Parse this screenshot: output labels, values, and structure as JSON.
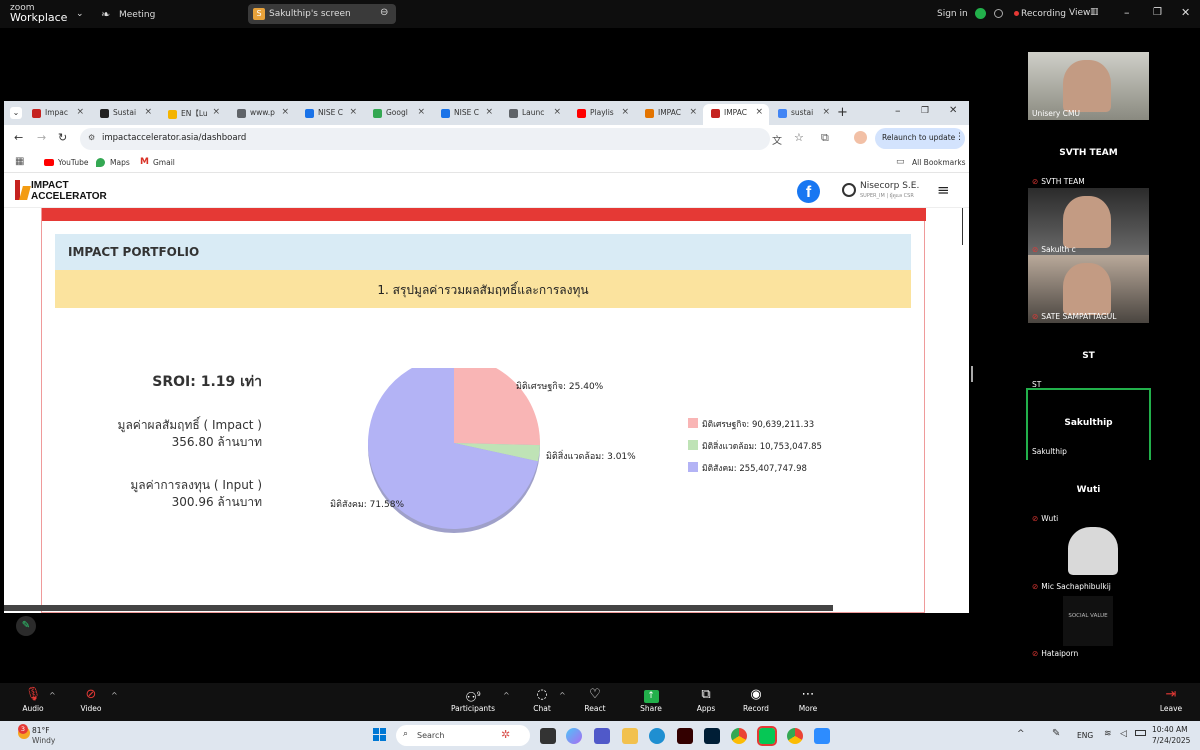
{
  "zoom": {
    "brand_small": "zoom",
    "brand": "Workplace",
    "meeting_label": "Meeting",
    "share_initial": "S",
    "share_label": "Sakulthip's screen",
    "sign_in": "Sign in",
    "recording": "Recording",
    "view": "View"
  },
  "browser": {
    "tabs": [
      {
        "label": "Impac",
        "color": "#c5221f"
      },
      {
        "label": "Sustai",
        "color": "#222222"
      },
      {
        "label": "EN【Lu",
        "color": "#f4b400"
      },
      {
        "label": "www.p",
        "color": "#5f6368"
      },
      {
        "label": "NISE C",
        "color": "#1a73e8"
      },
      {
        "label": "Googl",
        "color": "#34a853"
      },
      {
        "label": "NISE C",
        "color": "#1a73e8"
      },
      {
        "label": "Launc",
        "color": "#5f6368"
      },
      {
        "label": "Playlis",
        "color": "#ff0000"
      },
      {
        "label": "IMPAC",
        "color": "#e37400"
      },
      {
        "label": "IMPAC",
        "color": "#c5221f"
      },
      {
        "label": "sustai",
        "color": "#4285f4"
      }
    ],
    "url": "impactaccelerator.asia/dashboard",
    "relaunch": "Relaunch to update",
    "bookmarks": [
      "YouTube",
      "Maps",
      "Gmail"
    ],
    "all_bookmarks": "All Bookmarks"
  },
  "site": {
    "logo_line1": "IMPACT",
    "logo_line2": "ACCELERATOR",
    "user_name": "Nisecorp S.E.",
    "user_role": "SUPER_IM | ผู้ดูแล CSR"
  },
  "dashboard": {
    "section_title": "IMPACT PORTFOLIO",
    "subtitle": "1. สรุปมูลค่ารวมผลสัมฤทธิ์และการลงทุน",
    "sroi": "SROI: 1.19 เท่า",
    "impact_label": "มูลค่าผลสัมฤทธิ์ ( Impact )",
    "impact_value": "356.80 ล้านบาท",
    "input_label": "มูลค่าการลงทุน ( Input )",
    "input_value": "300.96 ล้านบาท"
  },
  "chart_data": {
    "type": "pie",
    "categories": [
      "มิติเศรษฐกิจ",
      "มิติสิ่งแวดล้อม",
      "มิติสังคม"
    ],
    "values": [
      90639211.33,
      10753047.85,
      255407747.98
    ],
    "percent_labels": [
      "มิติเศรษฐกิจ: 25.40%",
      "มิติสิ่งแวดล้อม: 3.01%",
      "มิติสังคม: 71.58%"
    ],
    "legend_labels": [
      "มิติเศรษฐกิจ: 90,639,211.33",
      "มิติสิ่งแวดล้อม: 10,753,047.85",
      "มิติสังคม: 255,407,747.98"
    ],
    "colors": [
      "#f9b5b5",
      "#bfe3b6",
      "#b3b3f5"
    ],
    "legend": "right"
  },
  "participants": [
    {
      "name": "Unisery CMU",
      "video": true
    },
    {
      "name": "SVTH TEAM",
      "center": "SVTH TEAM",
      "muted": true
    },
    {
      "name": "Sakulth c",
      "video": true,
      "muted": true
    },
    {
      "name": "SATE SAMPATTAGUL",
      "video": true,
      "muted": true
    },
    {
      "name": "ST",
      "center": "ST"
    },
    {
      "name": "Sakulthip",
      "center": "Sakulthip",
      "active": true
    },
    {
      "name": "Wuti",
      "center": "Wuti",
      "muted": true
    },
    {
      "name": "Mic Sachaphibulkij",
      "video": true,
      "muted": true
    },
    {
      "name": "Hataiporn",
      "logo_text": "SOCIAL VALUE",
      "muted": true
    }
  ],
  "controls": {
    "audio": "Audio",
    "video": "Video",
    "participants": "Participants",
    "participant_count": "9",
    "chat": "Chat",
    "react": "React",
    "share": "Share",
    "apps": "Apps",
    "record": "Record",
    "more": "More",
    "leave": "Leave"
  },
  "taskbar": {
    "weather_badge": "3",
    "temp": "81°F",
    "weather": "Windy",
    "search": "Search",
    "lang": "ENG",
    "time": "10:40 AM",
    "date": "7/24/2025"
  }
}
